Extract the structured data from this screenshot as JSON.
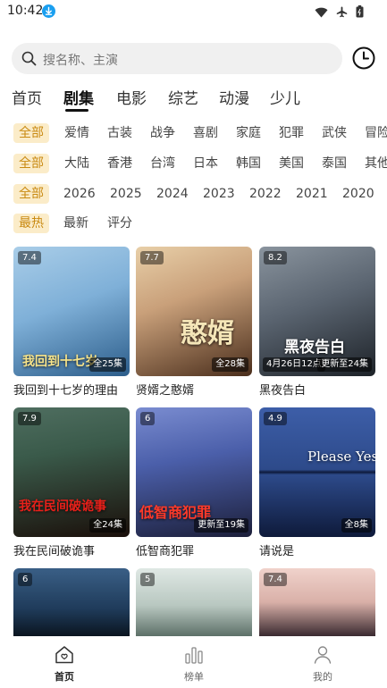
{
  "status": {
    "time": "10:42"
  },
  "search": {
    "placeholder": "搜名称、主演"
  },
  "tabs": [
    {
      "label": "首页"
    },
    {
      "label": "剧集"
    },
    {
      "label": "电影"
    },
    {
      "label": "综艺"
    },
    {
      "label": "动漫"
    },
    {
      "label": "少儿"
    }
  ],
  "active_tab": "剧集",
  "filters": {
    "genre": [
      "全部",
      "爱情",
      "古装",
      "战争",
      "喜剧",
      "家庭",
      "犯罪",
      "武侠",
      "冒险"
    ],
    "region": [
      "全部",
      "大陆",
      "香港",
      "台湾",
      "日本",
      "韩国",
      "美国",
      "泰国",
      "其他"
    ],
    "year": [
      "全部",
      "2026",
      "2025",
      "2024",
      "2023",
      "2022",
      "2021",
      "2020"
    ],
    "sort": [
      "最热",
      "最新",
      "评分"
    ]
  },
  "cards": [
    {
      "title": "我回到十七岁的理由",
      "score": "7.4",
      "episodes": "全25集",
      "poster_text": "我回到十七岁",
      "color1": "#7fb0d8",
      "color2": "#2c5d8a"
    },
    {
      "title": "贤婿之憨婿",
      "score": "7.7",
      "episodes": "全28集",
      "poster_text": "憨婿",
      "color1": "#c9a07a",
      "color2": "#4a2e1c"
    },
    {
      "title": "黑夜告白",
      "score": "8.2",
      "episodes": "更新至24集",
      "date_badge": "4月26日12点",
      "poster_text": "黑夜告白",
      "color1": "#5a6470",
      "color2": "#1d2228"
    },
    {
      "title": "我在民间破诡事",
      "score": "7.9",
      "episodes": "全24集",
      "poster_text": "我在民间破诡事",
      "color1": "#3a5a4a",
      "color2": "#1a0f0a"
    },
    {
      "title": "低智商犯罪",
      "score": "6",
      "episodes": "更新至19集",
      "poster_text": "低智商犯罪",
      "color1": "#4b5faa",
      "color2": "#1c1f3a"
    },
    {
      "title": "请说是",
      "score": "4.9",
      "episodes": "全8集",
      "poster_text": "Please Yes",
      "color1": "#2d4a8a",
      "color2": "#0e1a3a"
    },
    {
      "title": "",
      "score": "6",
      "episodes": "",
      "poster_text": "",
      "color1": "#1f3b5a",
      "color2": "#0b1520"
    },
    {
      "title": "",
      "score": "5",
      "episodes": "",
      "poster_text": "",
      "color1": "#b8c7c0",
      "color2": "#5d7068"
    },
    {
      "title": "",
      "score": "7.4",
      "episodes": "",
      "poster_text": "",
      "color1": "#d9b0a8",
      "color2": "#3a2a30"
    }
  ],
  "bottom_nav": [
    {
      "label": "首页"
    },
    {
      "label": "榜单"
    },
    {
      "label": "我的"
    }
  ],
  "colors": {
    "accent": "#c98a12",
    "chip_bg": "#fbecc9",
    "download_badge": "#1a9ff0"
  }
}
